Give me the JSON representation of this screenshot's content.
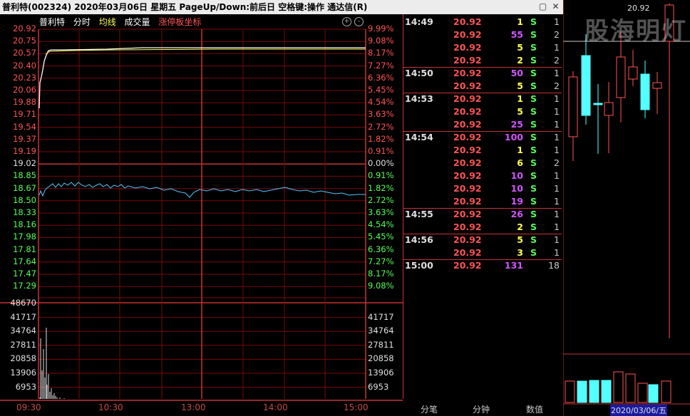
{
  "window": {
    "title": "普利特(002324)  2020年03月06日 星期五  PageUp/Down:前后日  空格键:操作  通达信(R)"
  },
  "chart_tabs": {
    "name": "普利特",
    "fenshi": "分时",
    "avg": "均线",
    "volume": "成交量",
    "limit_coord": "涨停板坐标",
    "btn_plus": "+",
    "btn_minus": "-"
  },
  "price_axis": {
    "left": [
      "20.92",
      "20.75",
      "20.57",
      "20.40",
      "20.23",
      "20.06",
      "19.88",
      "19.71",
      "19.54",
      "19.37",
      "19.19",
      "19.02",
      "18.85",
      "18.67",
      "18.50",
      "18.33",
      "18.16",
      "17.98",
      "17.81",
      "17.64",
      "17.47",
      "17.29"
    ],
    "right": [
      "9.99%",
      "9.08%",
      "8.17%",
      "7.27%",
      "6.36%",
      "5.45%",
      "4.54%",
      "3.63%",
      "2.72%",
      "1.82%",
      "0.91%",
      "0.00%",
      "0.91%",
      "1.82%",
      "2.72%",
      "3.63%",
      "4.54%",
      "5.45%",
      "6.36%",
      "7.27%",
      "8.17%",
      "9.08%"
    ]
  },
  "volume_axis": {
    "left": [
      "48670",
      "41717",
      "34764",
      "27811",
      "20858",
      "13906",
      "6953"
    ],
    "right": [
      "41717",
      "34764",
      "27811",
      "20858",
      "13906",
      "6953"
    ]
  },
  "time_axis": [
    "09:30",
    "10:30",
    "13:00",
    "14:00",
    "15:00"
  ],
  "colors": {
    "up": "#ff5454",
    "down": "#54ff54",
    "price_line": "#ffffff",
    "avg_line": "#ffff54",
    "grid": "#8b0000",
    "kline_down": "#54ffff"
  },
  "trades": [
    {
      "time": "14:49",
      "price": "20.92",
      "vol": "1",
      "side": "S",
      "n": "1"
    },
    {
      "time": "",
      "price": "20.92",
      "vol": "55",
      "side": "S",
      "n": "2"
    },
    {
      "time": "",
      "price": "20.92",
      "vol": "5",
      "side": "S",
      "n": "1"
    },
    {
      "time": "",
      "price": "20.92",
      "vol": "2",
      "side": "S",
      "n": "2"
    },
    {
      "time": "14:50",
      "price": "20.92",
      "vol": "50",
      "side": "S",
      "n": "1"
    },
    {
      "time": "",
      "price": "20.92",
      "vol": "5",
      "side": "S",
      "n": "2"
    },
    {
      "time": "14:53",
      "price": "20.92",
      "vol": "1",
      "side": "S",
      "n": "1"
    },
    {
      "time": "",
      "price": "20.92",
      "vol": "5",
      "side": "S",
      "n": "1"
    },
    {
      "time": "",
      "price": "20.92",
      "vol": "25",
      "side": "S",
      "n": "1"
    },
    {
      "time": "14:54",
      "price": "20.92",
      "vol": "100",
      "side": "S",
      "n": "1"
    },
    {
      "time": "",
      "price": "20.92",
      "vol": "1",
      "side": "S",
      "n": "1"
    },
    {
      "time": "",
      "price": "20.92",
      "vol": "6",
      "side": "S",
      "n": "2"
    },
    {
      "time": "",
      "price": "20.92",
      "vol": "10",
      "side": "S",
      "n": "1"
    },
    {
      "time": "",
      "price": "20.92",
      "vol": "10",
      "side": "S",
      "n": "1"
    },
    {
      "time": "",
      "price": "20.92",
      "vol": "19",
      "side": "S",
      "n": "1"
    },
    {
      "time": "14:55",
      "price": "20.92",
      "vol": "26",
      "side": "S",
      "n": "1"
    },
    {
      "time": "",
      "price": "20.92",
      "vol": "2",
      "side": "S",
      "n": "1"
    },
    {
      "time": "14:56",
      "price": "20.92",
      "vol": "5",
      "side": "S",
      "n": "1"
    },
    {
      "time": "",
      "price": "20.92",
      "vol": "3",
      "side": "S",
      "n": "1"
    },
    {
      "time": "15:00",
      "price": "20.92",
      "vol": "131",
      "side": "",
      "n": "18"
    }
  ],
  "bottom_tabs": {
    "t1": "分笔",
    "t2": "分钟",
    "t3": "数值"
  },
  "kchart": {
    "last_price": "20.92",
    "date": "2020/03/06/五",
    "watermark": "股海明灯"
  }
}
